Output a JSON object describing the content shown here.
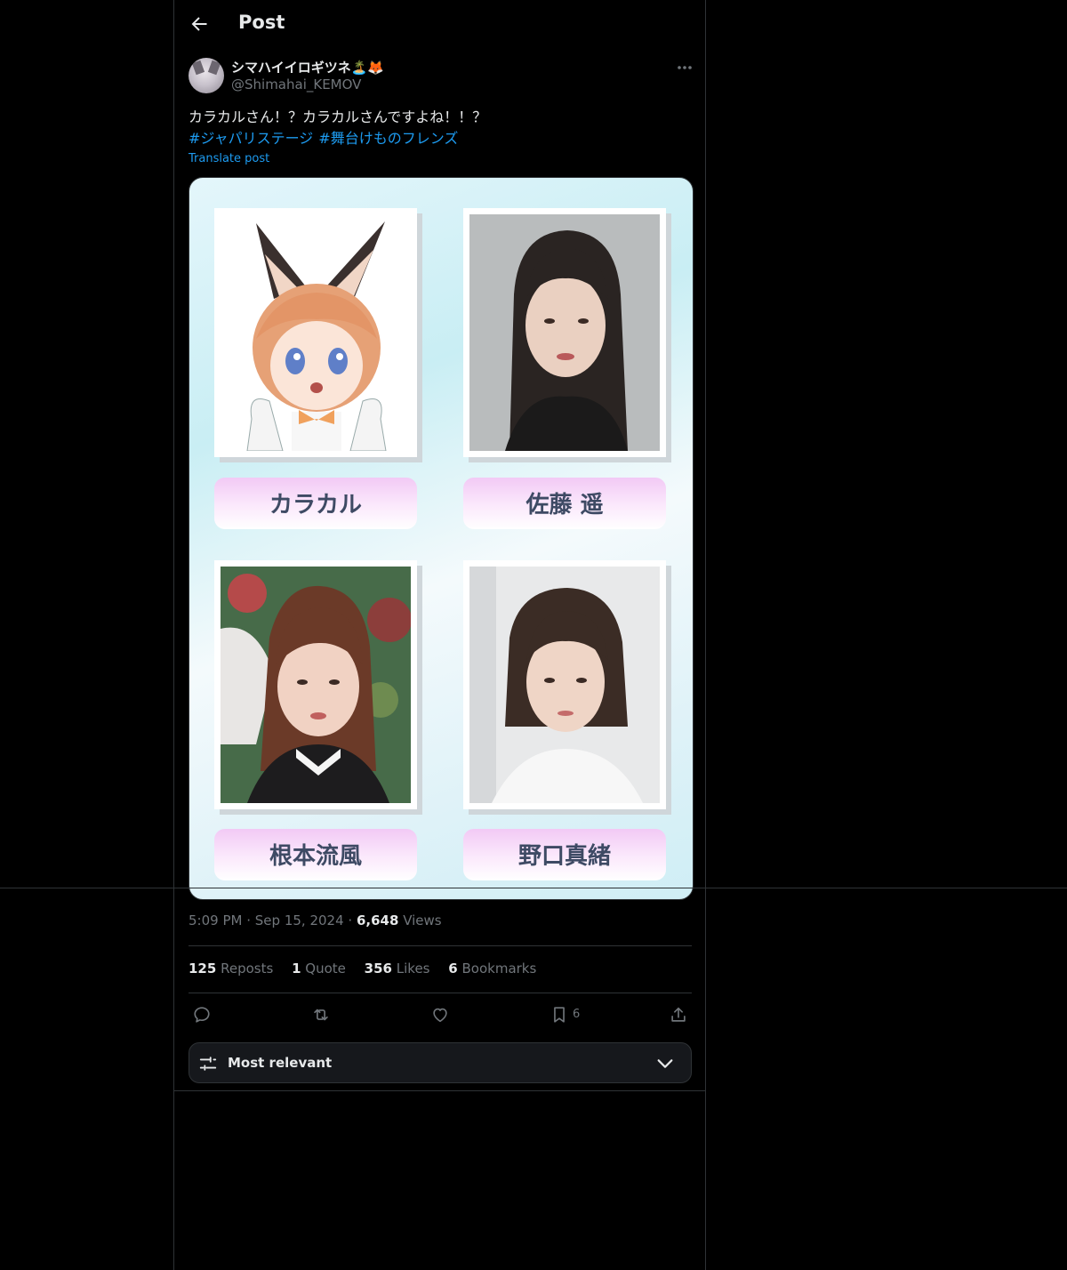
{
  "header": {
    "title": "Post",
    "back_icon": "back-arrow-icon"
  },
  "post": {
    "author": {
      "display_name": "シマハイイロギツネ🏝️🦊",
      "handle": "@Shimahai_KEMOV"
    },
    "text": "カラカルさん！？カラカルさんですよね！！？",
    "hashtags": [
      "#ジャパリステージ",
      "#舞台けものフレンズ"
    ],
    "translate_label": "Translate post",
    "media": {
      "cards": [
        {
          "name": "カラカル"
        },
        {
          "name": "佐藤 遥"
        },
        {
          "name": "根本流風"
        },
        {
          "name": "野口真緒"
        }
      ]
    },
    "meta": {
      "time": "5:09 PM",
      "date": "Sep 15, 2024",
      "views_count": "6,648",
      "views_label": "Views"
    },
    "stats": {
      "reposts": {
        "count": "125",
        "label": "Reposts"
      },
      "quotes": {
        "count": "1",
        "label": "Quote"
      },
      "likes": {
        "count": "356",
        "label": "Likes"
      },
      "bookmarks": {
        "count": "6",
        "label": "Bookmarks"
      }
    },
    "actions": {
      "bookmark_count": "6"
    }
  },
  "sort": {
    "label": "Most relevant"
  },
  "colors": {
    "accent": "#1d9bf0",
    "muted": "#71767b",
    "border": "#2f3336",
    "text": "#e7e9ea"
  }
}
